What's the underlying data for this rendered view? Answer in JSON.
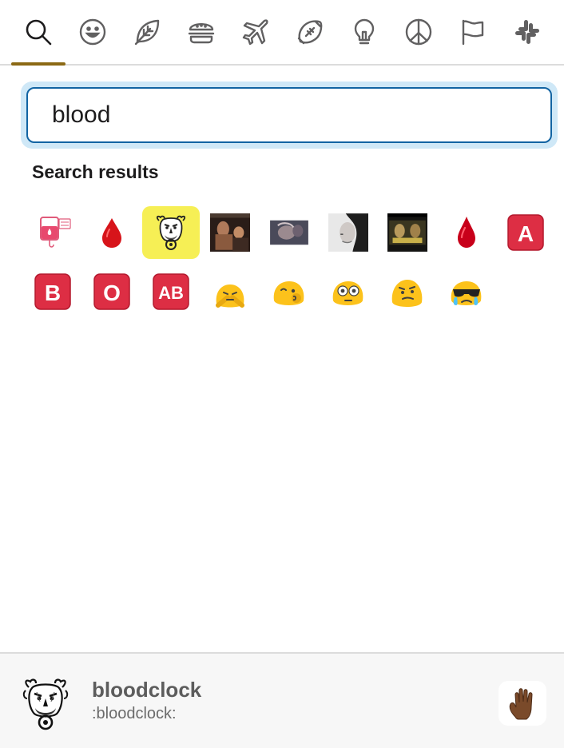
{
  "tabs": [
    {
      "name": "search-icon",
      "label": "Search"
    },
    {
      "name": "smiley-icon",
      "label": "Smileys & People"
    },
    {
      "name": "leaf-icon",
      "label": "Nature"
    },
    {
      "name": "burger-icon",
      "label": "Food & Drink"
    },
    {
      "name": "airplane-icon",
      "label": "Travel & Places"
    },
    {
      "name": "football-icon",
      "label": "Activities"
    },
    {
      "name": "lightbulb-icon",
      "label": "Objects"
    },
    {
      "name": "peace-icon",
      "label": "Symbols"
    },
    {
      "name": "flag-icon",
      "label": "Flags"
    },
    {
      "name": "slack-icon",
      "label": "Custom"
    }
  ],
  "active_tab": "search-icon",
  "search": {
    "value": "blood",
    "placeholder": ""
  },
  "section_title": "Search results",
  "results": [
    {
      "name": "blood-bag-emoji"
    },
    {
      "name": "drop-of-blood-emoji"
    },
    {
      "name": "bloodclock-emoji",
      "selected": true
    },
    {
      "name": "custom-photo-emoji-1"
    },
    {
      "name": "custom-photo-emoji-2"
    },
    {
      "name": "custom-photo-emoji-3"
    },
    {
      "name": "custom-photo-emoji-4"
    },
    {
      "name": "drop-of-blood-emoji-2"
    },
    {
      "name": "a-blood-type-emoji",
      "text": "A"
    },
    {
      "name": "b-blood-type-emoji",
      "text": "B"
    },
    {
      "name": "o-blood-type-emoji",
      "text": "O"
    },
    {
      "name": "ab-blood-type-emoji",
      "text": "AB"
    },
    {
      "name": "no-gesture-blob-emoji"
    },
    {
      "name": "face-blowing-kiss-blob-emoji"
    },
    {
      "name": "flushed-blob-emoji"
    },
    {
      "name": "confused-blob-emoji"
    },
    {
      "name": "sunglasses-crying-blob-emoji"
    }
  ],
  "preview": {
    "name": "bloodclock",
    "code": ":bloodclock:"
  },
  "colors": {
    "accent": "#8b6914",
    "focus": "#1264a3",
    "selected_bg": "#f6ef55",
    "blood_type_red": "#dd2e44"
  }
}
